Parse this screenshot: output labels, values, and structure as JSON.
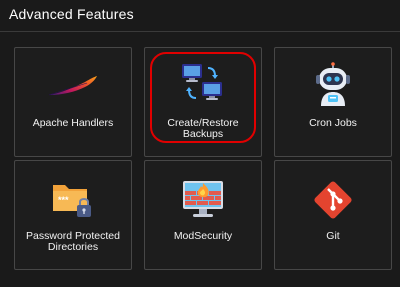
{
  "section": {
    "title": "Advanced Features"
  },
  "tiles": [
    {
      "label": "Apache Handlers",
      "icon": "apache-feather-icon"
    },
    {
      "label": "Create/Restore Backups",
      "icon": "backup-computers-icon"
    },
    {
      "label": "Cron Jobs",
      "icon": "robot-icon"
    },
    {
      "label": "Password Protected Directories",
      "icon": "locked-folder-icon"
    },
    {
      "label": "ModSecurity",
      "icon": "firewall-monitor-icon"
    },
    {
      "label": "Git",
      "icon": "git-icon"
    }
  ],
  "colors": {
    "background": "#1a1a1a",
    "tile_border": "#474747",
    "highlight": "#e10000",
    "text": "#ffffff"
  }
}
